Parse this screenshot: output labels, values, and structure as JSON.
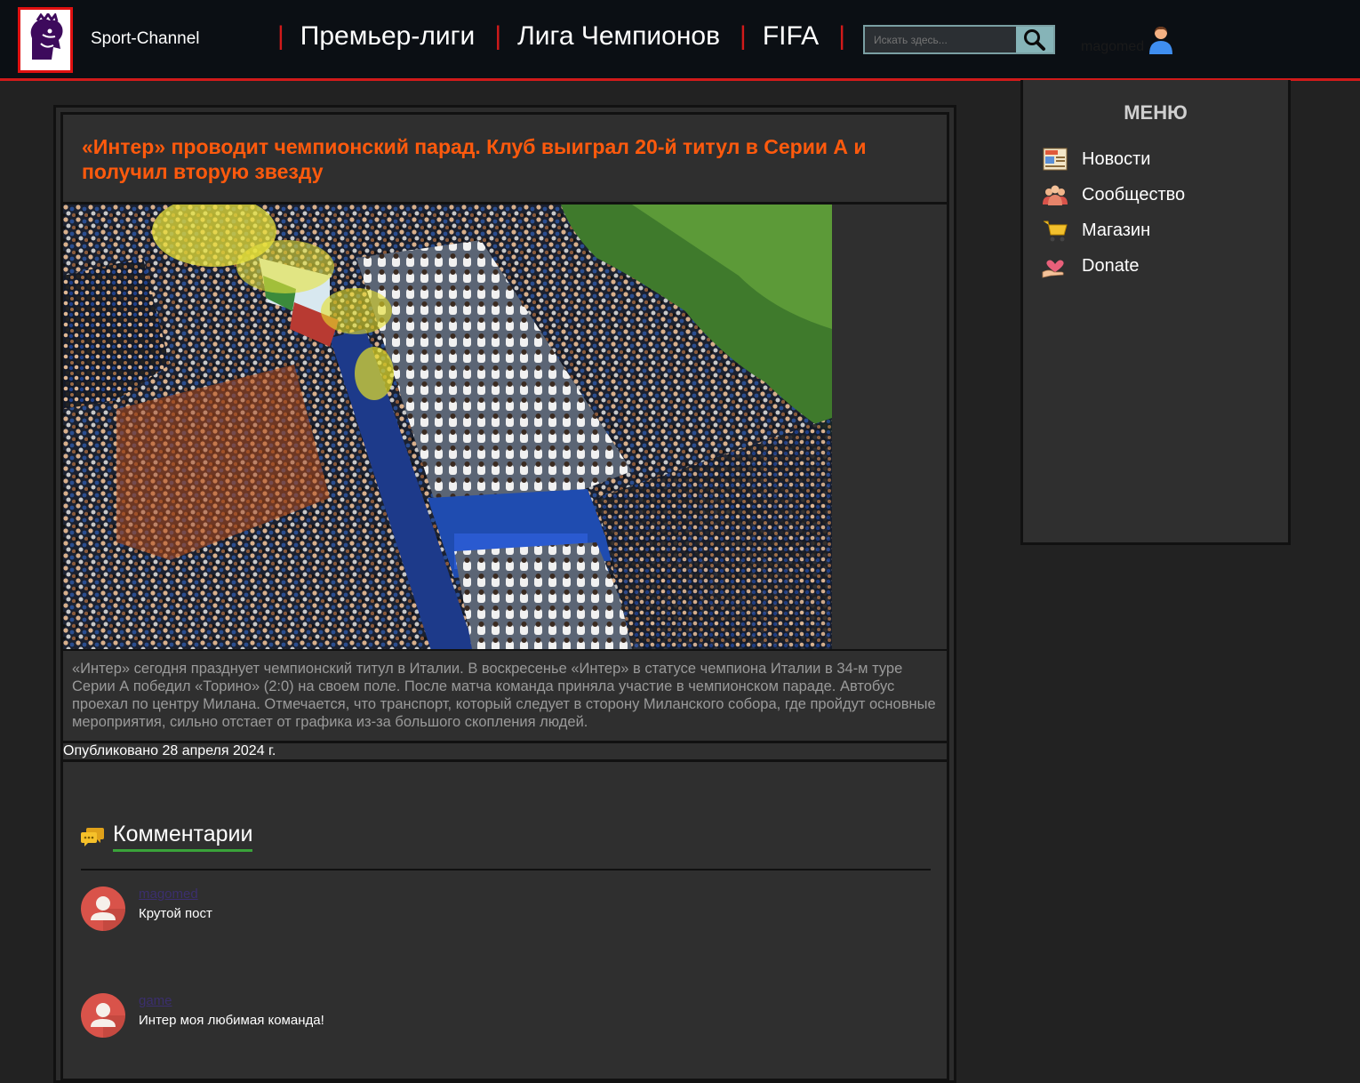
{
  "header": {
    "brand": "Sport-Channel",
    "nav": [
      {
        "label": "Премьер-лиги"
      },
      {
        "label": "Лига Чемпионов"
      },
      {
        "label": "FIFA"
      }
    ],
    "search": {
      "placeholder": "Искать здесь..."
    },
    "user": {
      "name": "magomed"
    }
  },
  "article": {
    "title": "«Интер» проводит чемпионский парад. Клуб выиграл 20-й титул в Серии А и получил вторую звезду",
    "image_alt": "Чемпионский парад «Интера»",
    "body": "«Интер» сегодня празднует чемпионский титул в Италии. В воскресенье «Интер» в статусе чемпиона Италии в 34-м туре Серии А победил «Торино» (2:0) на своем поле. После матча команда приняла участие в чемпионском параде. Автобус проехал по центру Милана. Отмечается, что транспорт, который следует в сторону Миланского собора, где пройдут основные мероприятия, сильно отстает от графика из-за большого скопления людей.",
    "published": "Опубликовано 28 апреля 2024 г."
  },
  "comments": {
    "title": "Комментарии",
    "items": [
      {
        "author": "magomed",
        "text": "Крутой пост"
      },
      {
        "author": "game",
        "text": "Интер моя любимая команда!"
      }
    ]
  },
  "sidebar": {
    "title": "МЕНЮ",
    "items": [
      {
        "label": "Новости",
        "icon": "newspaper-icon"
      },
      {
        "label": "Сообщество",
        "icon": "community-icon"
      },
      {
        "label": "Магазин",
        "icon": "cart-icon"
      },
      {
        "label": "Donate",
        "icon": "donate-heart-icon"
      }
    ]
  },
  "colors": {
    "accent_red": "#d11a1a",
    "title_orange": "#ff5a0d",
    "underline_green": "#3aa33a",
    "search_button": "#86b4b8"
  }
}
